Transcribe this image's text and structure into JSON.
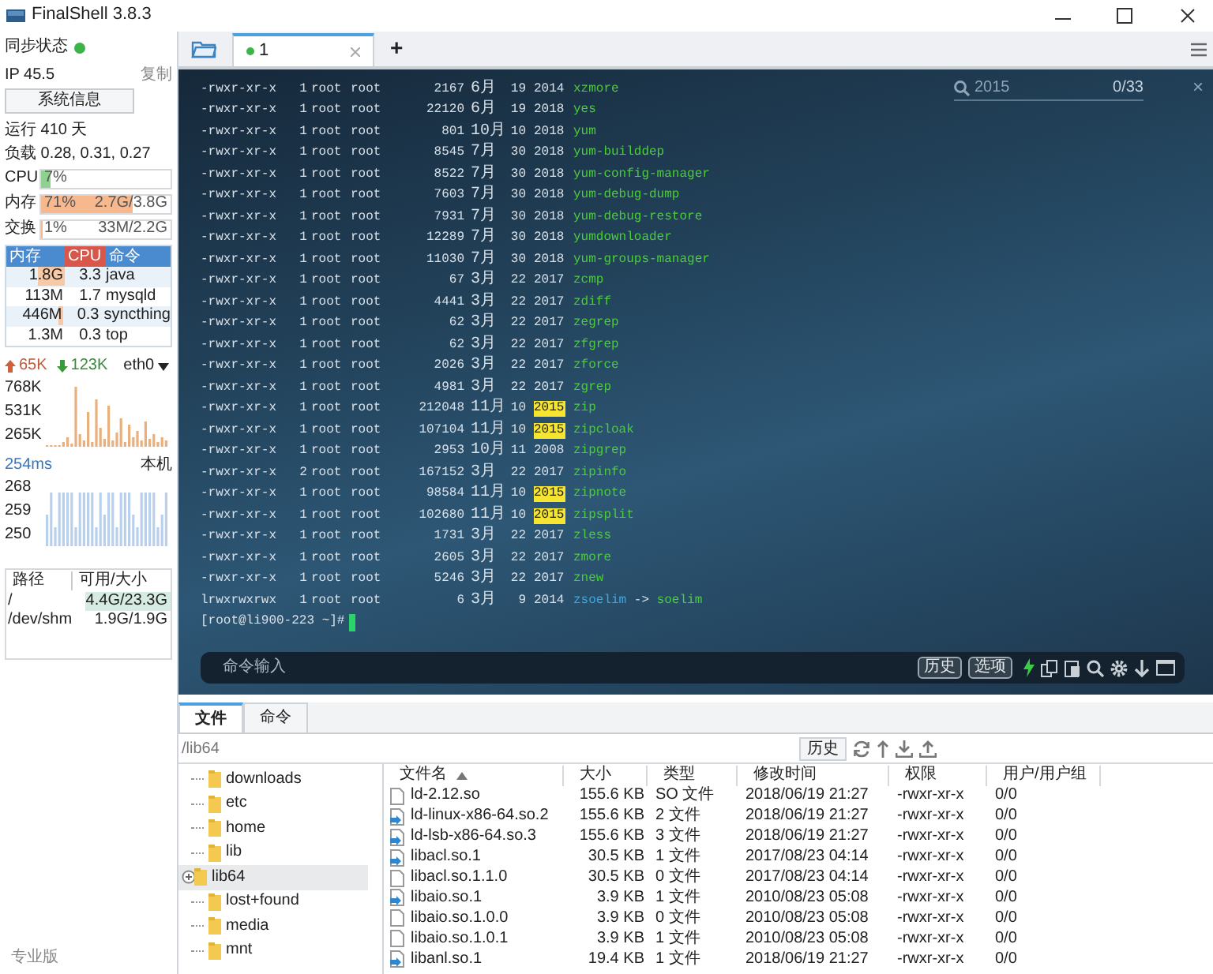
{
  "window": {
    "title": "FinalShell 3.8.3"
  },
  "sidebar": {
    "sync": {
      "label": "同步状态",
      "synced": true
    },
    "ip": {
      "label": "IP 45.5",
      "copy": "复制"
    },
    "sysinfo_button": "系统信息",
    "uptime": "运行 410 天",
    "load": "负载 0.28, 0.31, 0.27",
    "meters": [
      {
        "label": "CPU",
        "percent": "7%",
        "level": 0.07,
        "color": "#8fd18f"
      },
      {
        "label": "内存",
        "percent": "71%",
        "reading": "2.7G/3.8G",
        "level": 0.71,
        "color": "#f8b88e"
      },
      {
        "label": "交换",
        "percent": "1%",
        "reading": "33M/2.2G",
        "level": 0.01,
        "color": "#f8b88e"
      }
    ],
    "processes": {
      "columns": [
        {
          "label": "内存",
          "selected": false
        },
        {
          "label": "CPU",
          "selected": true
        },
        {
          "label": "命令",
          "selected": false
        }
      ],
      "rows": [
        {
          "mem": "1.8G",
          "level": 0.45,
          "cpu": "3.3",
          "command": "java"
        },
        {
          "mem": "113M",
          "level": 0,
          "cpu": "1.7",
          "command": "mysqld"
        },
        {
          "mem": "446M",
          "level": 0.1,
          "cpu": "0.3",
          "command": "syncthing"
        },
        {
          "mem": "1.3M",
          "level": 0,
          "cpu": "0.3",
          "command": "top"
        }
      ]
    },
    "network": {
      "up": "65K",
      "down": "123K",
      "interface": "eth0",
      "ticks": [
        "768K",
        "531K",
        "265K"
      ]
    },
    "ping": {
      "latency": "254ms",
      "host": "本机",
      "ticks": [
        "268",
        "259",
        "250"
      ]
    },
    "disks": {
      "columns": [
        "路径",
        "可用/大小"
      ],
      "rows": [
        {
          "path": "/",
          "size": "4.4G/23.3G",
          "selected": true
        },
        {
          "path": "/dev/shm",
          "size": "1.9G/1.9G",
          "selected": false
        }
      ]
    },
    "edition": "专业版"
  },
  "tabs": [
    {
      "label": "1",
      "selected": true,
      "connected": true
    }
  ],
  "new_tab": "+",
  "terminal": {
    "search": {
      "value": "2015",
      "count": "0/33",
      "close": "×"
    },
    "rows": [
      {
        "kind": "file",
        "perms": "-rwxr-xr-x",
        "links": "1",
        "owner": "root",
        "group": "root",
        "size": "2167",
        "month": "6月",
        "day": "19",
        "year": "2014",
        "name": "xzmore",
        "highlighted": false
      },
      {
        "kind": "file",
        "perms": "-rwxr-xr-x",
        "links": "1",
        "owner": "root",
        "group": "root",
        "size": "22120",
        "month": "6月",
        "day": "19",
        "year": "2018",
        "name": "yes",
        "highlighted": false
      },
      {
        "kind": "file",
        "perms": "-rwxr-xr-x",
        "links": "1",
        "owner": "root",
        "group": "root",
        "size": "801",
        "month": "10月",
        "day": "10",
        "year": "2018",
        "name": "yum",
        "highlighted": false
      },
      {
        "kind": "file",
        "perms": "-rwxr-xr-x",
        "links": "1",
        "owner": "root",
        "group": "root",
        "size": "8545",
        "month": "7月",
        "day": "30",
        "year": "2018",
        "name": "yum-builddep",
        "highlighted": false
      },
      {
        "kind": "file",
        "perms": "-rwxr-xr-x",
        "links": "1",
        "owner": "root",
        "group": "root",
        "size": "8522",
        "month": "7月",
        "day": "30",
        "year": "2018",
        "name": "yum-config-manager",
        "highlighted": false
      },
      {
        "kind": "file",
        "perms": "-rwxr-xr-x",
        "links": "1",
        "owner": "root",
        "group": "root",
        "size": "7603",
        "month": "7月",
        "day": "30",
        "year": "2018",
        "name": "yum-debug-dump",
        "highlighted": false
      },
      {
        "kind": "file",
        "perms": "-rwxr-xr-x",
        "links": "1",
        "owner": "root",
        "group": "root",
        "size": "7931",
        "month": "7月",
        "day": "30",
        "year": "2018",
        "name": "yum-debug-restore",
        "highlighted": false
      },
      {
        "kind": "file",
        "perms": "-rwxr-xr-x",
        "links": "1",
        "owner": "root",
        "group": "root",
        "size": "12289",
        "month": "7月",
        "day": "30",
        "year": "2018",
        "name": "yumdownloader",
        "highlighted": false
      },
      {
        "kind": "file",
        "perms": "-rwxr-xr-x",
        "links": "1",
        "owner": "root",
        "group": "root",
        "size": "11030",
        "month": "7月",
        "day": "30",
        "year": "2018",
        "name": "yum-groups-manager",
        "highlighted": false
      },
      {
        "kind": "file",
        "perms": "-rwxr-xr-x",
        "links": "1",
        "owner": "root",
        "group": "root",
        "size": "67",
        "month": "3月",
        "day": "22",
        "year": "2017",
        "name": "zcmp",
        "highlighted": false
      },
      {
        "kind": "file",
        "perms": "-rwxr-xr-x",
        "links": "1",
        "owner": "root",
        "group": "root",
        "size": "4441",
        "month": "3月",
        "day": "22",
        "year": "2017",
        "name": "zdiff",
        "highlighted": false
      },
      {
        "kind": "file",
        "perms": "-rwxr-xr-x",
        "links": "1",
        "owner": "root",
        "group": "root",
        "size": "62",
        "month": "3月",
        "day": "22",
        "year": "2017",
        "name": "zegrep",
        "highlighted": false
      },
      {
        "kind": "file",
        "perms": "-rwxr-xr-x",
        "links": "1",
        "owner": "root",
        "group": "root",
        "size": "62",
        "month": "3月",
        "day": "22",
        "year": "2017",
        "name": "zfgrep",
        "highlighted": false
      },
      {
        "kind": "file",
        "perms": "-rwxr-xr-x",
        "links": "1",
        "owner": "root",
        "group": "root",
        "size": "2026",
        "month": "3月",
        "day": "22",
        "year": "2017",
        "name": "zforce",
        "highlighted": false
      },
      {
        "kind": "file",
        "perms": "-rwxr-xr-x",
        "links": "1",
        "owner": "root",
        "group": "root",
        "size": "4981",
        "month": "3月",
        "day": "22",
        "year": "2017",
        "name": "zgrep",
        "highlighted": false
      },
      {
        "kind": "file",
        "perms": "-rwxr-xr-x",
        "links": "1",
        "owner": "root",
        "group": "root",
        "size": "212048",
        "month": "11月",
        "day": "10",
        "year": "2015",
        "name": "zip",
        "highlighted": true
      },
      {
        "kind": "file",
        "perms": "-rwxr-xr-x",
        "links": "1",
        "owner": "root",
        "group": "root",
        "size": "107104",
        "month": "11月",
        "day": "10",
        "year": "2015",
        "name": "zipcloak",
        "highlighted": true
      },
      {
        "kind": "file",
        "perms": "-rwxr-xr-x",
        "links": "1",
        "owner": "root",
        "group": "root",
        "size": "2953",
        "month": "10月",
        "day": "11",
        "year": "2008",
        "name": "zipgrep",
        "highlighted": false
      },
      {
        "kind": "file",
        "perms": "-rwxr-xr-x",
        "links": "2",
        "owner": "root",
        "group": "root",
        "size": "167152",
        "month": "3月",
        "day": "22",
        "year": "2017",
        "name": "zipinfo",
        "highlighted": false
      },
      {
        "kind": "file",
        "perms": "-rwxr-xr-x",
        "links": "1",
        "owner": "root",
        "group": "root",
        "size": "98584",
        "month": "11月",
        "day": "10",
        "year": "2015",
        "name": "zipnote",
        "highlighted": true
      },
      {
        "kind": "file",
        "perms": "-rwxr-xr-x",
        "links": "1",
        "owner": "root",
        "group": "root",
        "size": "102680",
        "month": "11月",
        "day": "10",
        "year": "2015",
        "name": "zipsplit",
        "highlighted": true
      },
      {
        "kind": "file",
        "perms": "-rwxr-xr-x",
        "links": "1",
        "owner": "root",
        "group": "root",
        "size": "1731",
        "month": "3月",
        "day": "22",
        "year": "2017",
        "name": "zless",
        "highlighted": false
      },
      {
        "kind": "file",
        "perms": "-rwxr-xr-x",
        "links": "1",
        "owner": "root",
        "group": "root",
        "size": "2605",
        "month": "3月",
        "day": "22",
        "year": "2017",
        "name": "zmore",
        "highlighted": false
      },
      {
        "kind": "file",
        "perms": "-rwxr-xr-x",
        "links": "1",
        "owner": "root",
        "group": "root",
        "size": "5246",
        "month": "3月",
        "day": "22",
        "year": "2017",
        "name": "znew",
        "highlighted": false
      },
      {
        "kind": "link",
        "perms": "lrwxrwxrwx",
        "links": "1",
        "owner": "root",
        "group": "root",
        "size": "6",
        "month": "3月",
        "day": "9",
        "year": "2014",
        "name": "zsoelim",
        "arrow": "->",
        "target": "soelim",
        "highlighted": false
      }
    ],
    "prompt": "[root@li900-223 ~]#",
    "command_bar": {
      "placeholder": "命令输入",
      "buttons": [
        "历史",
        "选项"
      ]
    }
  },
  "bottom_tabs": [
    {
      "label": "文件",
      "selected": true
    },
    {
      "label": "命令",
      "selected": false
    }
  ],
  "file_browser": {
    "path": "/lib64",
    "history_button": "历史",
    "tree": [
      {
        "label": "downloads",
        "selected": false,
        "expandable": false
      },
      {
        "label": "etc",
        "selected": false,
        "expandable": false
      },
      {
        "label": "home",
        "selected": false,
        "expandable": false
      },
      {
        "label": "lib",
        "selected": false,
        "expandable": false
      },
      {
        "label": "lib64",
        "selected": true,
        "expandable": true
      },
      {
        "label": "lost+found",
        "selected": false,
        "expandable": false
      },
      {
        "label": "media",
        "selected": false,
        "expandable": false
      },
      {
        "label": "mnt",
        "selected": false,
        "expandable": false
      }
    ],
    "columns": [
      {
        "label": "文件名",
        "sorted": true
      },
      {
        "label": "大小",
        "sorted": false
      },
      {
        "label": "类型",
        "sorted": false
      },
      {
        "label": "修改时间",
        "sorted": false
      },
      {
        "label": "权限",
        "sorted": false
      },
      {
        "label": "用户/用户组",
        "sorted": false
      }
    ],
    "files": [
      {
        "kind": "file",
        "name": "ld-2.12.so",
        "size": "155.6 KB",
        "type": "SO 文件",
        "modified": "2018/06/19 21:27",
        "permissions": "-rwxr-xr-x",
        "owner": "0/0"
      },
      {
        "kind": "link",
        "name": "ld-linux-x86-64.so.2",
        "size": "155.6 KB",
        "type": "2 文件",
        "modified": "2018/06/19 21:27",
        "permissions": "-rwxr-xr-x",
        "owner": "0/0"
      },
      {
        "kind": "link",
        "name": "ld-lsb-x86-64.so.3",
        "size": "155.6 KB",
        "type": "3 文件",
        "modified": "2018/06/19 21:27",
        "permissions": "-rwxr-xr-x",
        "owner": "0/0"
      },
      {
        "kind": "link",
        "name": "libacl.so.1",
        "size": "30.5 KB",
        "type": "1 文件",
        "modified": "2017/08/23 04:14",
        "permissions": "-rwxr-xr-x",
        "owner": "0/0"
      },
      {
        "kind": "file",
        "name": "libacl.so.1.1.0",
        "size": "30.5 KB",
        "type": "0 文件",
        "modified": "2017/08/23 04:14",
        "permissions": "-rwxr-xr-x",
        "owner": "0/0"
      },
      {
        "kind": "link",
        "name": "libaio.so.1",
        "size": "3.9 KB",
        "type": "1 文件",
        "modified": "2010/08/23 05:08",
        "permissions": "-rwxr-xr-x",
        "owner": "0/0"
      },
      {
        "kind": "file",
        "name": "libaio.so.1.0.0",
        "size": "3.9 KB",
        "type": "0 文件",
        "modified": "2010/08/23 05:08",
        "permissions": "-rwxr-xr-x",
        "owner": "0/0"
      },
      {
        "kind": "file",
        "name": "libaio.so.1.0.1",
        "size": "3.9 KB",
        "type": "1 文件",
        "modified": "2010/08/23 05:08",
        "permissions": "-rwxr-xr-x",
        "owner": "0/0"
      },
      {
        "kind": "link",
        "name": "libanl.so.1",
        "size": "19.4 KB",
        "type": "1 文件",
        "modified": "2018/06/19 21:27",
        "permissions": "-rwxr-xr-x",
        "owner": "0/0"
      }
    ]
  }
}
